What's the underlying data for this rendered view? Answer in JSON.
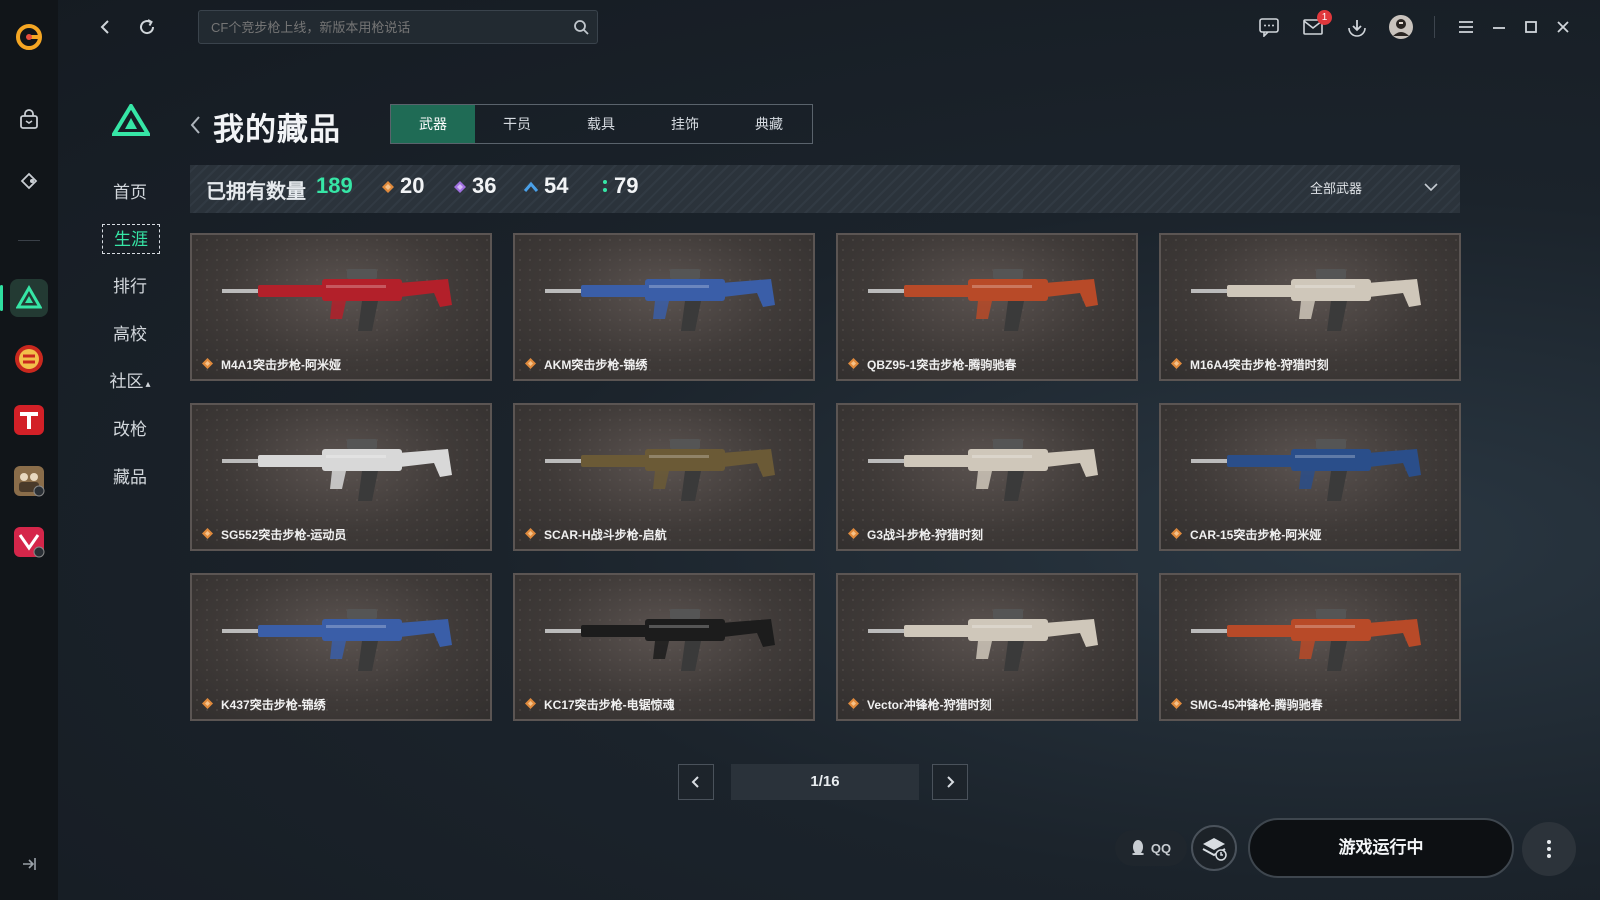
{
  "search": {
    "placeholder": "CF个竞步枪上线，新版本用枪说话"
  },
  "topbar": {
    "mail_badge": "1"
  },
  "page": {
    "title": "我的藏品"
  },
  "side_nav": {
    "items": [
      {
        "label": "首页"
      },
      {
        "label": "生涯"
      },
      {
        "label": "排行"
      },
      {
        "label": "高校"
      },
      {
        "label": "社区"
      },
      {
        "label": "改枪"
      },
      {
        "label": "藏品"
      }
    ]
  },
  "tabs": [
    {
      "label": "武器"
    },
    {
      "label": "干员"
    },
    {
      "label": "载具"
    },
    {
      "label": "挂饰"
    },
    {
      "label": "典藏"
    }
  ],
  "stats": {
    "owned_label": "已拥有数量",
    "total": "189",
    "tiers": [
      {
        "value": "20",
        "color": "#e08a3c"
      },
      {
        "value": "36",
        "color": "#a070e0"
      },
      {
        "value": "54",
        "color": "#4aa0e8"
      },
      {
        "value": "79",
        "color": "#36e6a6"
      }
    ],
    "filter": "全部武器"
  },
  "weapons": [
    {
      "name": "M4A1突击步枪-阿米娅",
      "color": "#b3202a"
    },
    {
      "name": "AKM突击步枪-锦绣",
      "color": "#3a5ea8"
    },
    {
      "name": "QBZ95-1突击步枪-腾驹驰春",
      "color": "#b84a28"
    },
    {
      "name": "M16A4突击步枪-狩猎时刻",
      "color": "#cfc7ba"
    },
    {
      "name": "SG552突击步枪-运动员",
      "color": "#d8d8d8"
    },
    {
      "name": "SCAR-H战斗步枪-启航",
      "color": "#6b5a36"
    },
    {
      "name": "G3战斗步枪-狩猎时刻",
      "color": "#cfc7ba"
    },
    {
      "name": "CAR-15突击步枪-阿米娅",
      "color": "#2a4e8a"
    },
    {
      "name": "K437突击步枪-锦绣",
      "color": "#3a5ea8"
    },
    {
      "name": "KC17突击步枪-电锯惊魂",
      "color": "#1c1c1c"
    },
    {
      "name": "Vector冲锋枪-狩猎时刻",
      "color": "#cfc7ba"
    },
    {
      "name": "SMG-45冲锋枪-腾驹驰春",
      "color": "#b84a28"
    }
  ],
  "pagination": {
    "current": "1/16"
  },
  "bottom": {
    "qq_label": "QQ",
    "launch_label": "游戏运行中"
  },
  "icons": {
    "rail": [
      "app-logo-icon",
      "bag-icon",
      "tag-icon",
      "delta-game-icon",
      "cf-game-icon",
      "t-game-icon",
      "team-game-icon",
      "v-game-icon"
    ]
  }
}
